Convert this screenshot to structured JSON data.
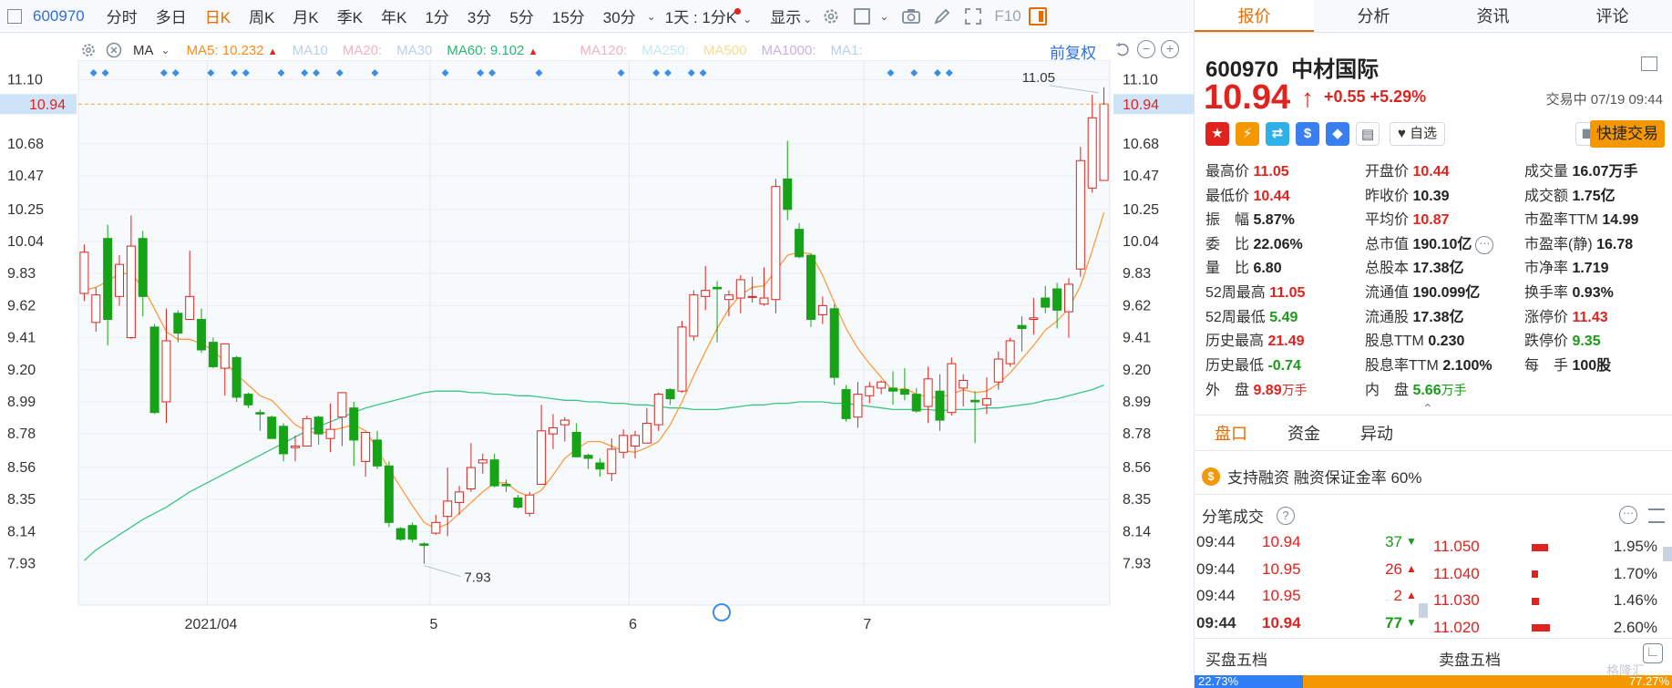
{
  "toolbar": {
    "code": "600970",
    "periods": [
      "分时",
      "多日",
      "日K",
      "周K",
      "月K",
      "季K",
      "年K",
      "1分",
      "3分",
      "5分",
      "15分",
      "30分"
    ],
    "active_period": "日K",
    "range_label": "1天 : 1分K",
    "display_label": "显示",
    "f10_label": "F10"
  },
  "indicators": {
    "ma_label": "MA",
    "ma5": "MA5: 10.232",
    "ma10": "MA10",
    "ma20": "MA20:",
    "ma30": "MA30",
    "ma60": "MA60: 9.102",
    "ma120": "MA120:",
    "ma250": "MA250:",
    "ma500": "MA500",
    "ma1000": "MA1000:",
    "ma1": "MA1:",
    "adjust_label": "前复权"
  },
  "chart_data": {
    "type": "candlestick",
    "title": "",
    "ylim": [
      7.85,
      11.18
    ],
    "yticks": [
      11.1,
      10.94,
      10.68,
      10.47,
      10.25,
      10.04,
      9.83,
      9.62,
      9.41,
      9.2,
      8.99,
      8.78,
      8.56,
      8.35,
      8.14,
      7.93
    ],
    "current_price_label": "10.94",
    "current_price": 10.94,
    "high_marker": {
      "label": "11.05",
      "value": 11.05
    },
    "low_marker": {
      "label": "7.93",
      "value": 7.93
    },
    "month_labels": [
      {
        "label": "2021/04",
        "index": 11
      },
      {
        "label": "5",
        "index": 30
      },
      {
        "label": "6",
        "index": 47
      },
      {
        "label": "7",
        "index": 67
      }
    ],
    "candles": [
      {
        "o": 9.7,
        "h": 10.02,
        "l": 9.65,
        "c": 9.97
      },
      {
        "o": 9.51,
        "h": 9.74,
        "l": 9.45,
        "c": 9.69
      },
      {
        "o": 10.06,
        "h": 10.15,
        "l": 9.36,
        "c": 9.53
      },
      {
        "o": 9.68,
        "h": 9.95,
        "l": 9.62,
        "c": 9.89
      },
      {
        "o": 9.41,
        "h": 10.21,
        "l": 9.4,
        "c": 10.01
      },
      {
        "o": 10.06,
        "h": 10.11,
        "l": 9.55,
        "c": 9.68
      },
      {
        "o": 9.48,
        "h": 9.5,
        "l": 8.91,
        "c": 8.92
      },
      {
        "o": 8.99,
        "h": 9.6,
        "l": 8.85,
        "c": 9.39
      },
      {
        "o": 9.57,
        "h": 9.59,
        "l": 9.38,
        "c": 9.44
      },
      {
        "o": 9.53,
        "h": 9.98,
        "l": 9.55,
        "c": 9.68
      },
      {
        "o": 9.53,
        "h": 9.6,
        "l": 9.31,
        "c": 9.33
      },
      {
        "o": 9.38,
        "h": 9.41,
        "l": 9.21,
        "c": 9.22
      },
      {
        "o": 9.21,
        "h": 9.23,
        "l": 9.03,
        "c": 9.37
      },
      {
        "o": 9.28,
        "h": 9.29,
        "l": 8.99,
        "c": 9.02
      },
      {
        "o": 9.04,
        "h": 9.05,
        "l": 8.95,
        "c": 8.97
      },
      {
        "o": 8.92,
        "h": 8.94,
        "l": 8.8,
        "c": 8.91
      },
      {
        "o": 8.89,
        "h": 8.9,
        "l": 8.79,
        "c": 8.75
      },
      {
        "o": 8.83,
        "h": 8.85,
        "l": 8.6,
        "c": 8.65
      },
      {
        "o": 8.69,
        "h": 8.77,
        "l": 8.6,
        "c": 8.7
      },
      {
        "o": 8.7,
        "h": 8.9,
        "l": 8.72,
        "c": 8.88
      },
      {
        "o": 8.89,
        "h": 8.9,
        "l": 8.71,
        "c": 8.78
      },
      {
        "o": 8.75,
        "h": 8.98,
        "l": 8.66,
        "c": 8.81
      },
      {
        "o": 8.89,
        "h": 9.05,
        "l": 8.7,
        "c": 9.05
      },
      {
        "o": 8.95,
        "h": 8.99,
        "l": 8.57,
        "c": 8.74
      },
      {
        "o": 8.6,
        "h": 8.78,
        "l": 8.5,
        "c": 8.79
      },
      {
        "o": 8.74,
        "h": 8.8,
        "l": 8.55,
        "c": 8.57
      },
      {
        "o": 8.57,
        "h": 8.6,
        "l": 8.17,
        "c": 8.2
      },
      {
        "o": 8.16,
        "h": 8.17,
        "l": 8.08,
        "c": 8.09
      },
      {
        "o": 8.18,
        "h": 8.2,
        "l": 8.07,
        "c": 8.09
      },
      {
        "o": 8.06,
        "h": 8.07,
        "l": 7.93,
        "c": 8.05
      },
      {
        "o": 8.13,
        "h": 8.25,
        "l": 8.12,
        "c": 8.2
      },
      {
        "o": 8.24,
        "h": 8.56,
        "l": 8.11,
        "c": 8.34
      },
      {
        "o": 8.33,
        "h": 8.44,
        "l": 8.25,
        "c": 8.4
      },
      {
        "o": 8.42,
        "h": 8.72,
        "l": 8.4,
        "c": 8.56
      },
      {
        "o": 8.59,
        "h": 8.65,
        "l": 8.52,
        "c": 8.61
      },
      {
        "o": 8.61,
        "h": 8.65,
        "l": 8.43,
        "c": 8.44
      },
      {
        "o": 8.45,
        "h": 8.48,
        "l": 8.4,
        "c": 8.44
      },
      {
        "o": 8.36,
        "h": 8.38,
        "l": 8.29,
        "c": 8.3
      },
      {
        "o": 8.26,
        "h": 8.4,
        "l": 8.24,
        "c": 8.38
      },
      {
        "o": 8.45,
        "h": 8.97,
        "l": 8.45,
        "c": 8.8
      },
      {
        "o": 8.78,
        "h": 8.91,
        "l": 8.68,
        "c": 8.82
      },
      {
        "o": 8.84,
        "h": 8.89,
        "l": 8.73,
        "c": 8.87
      },
      {
        "o": 8.79,
        "h": 8.85,
        "l": 8.65,
        "c": 8.63
      },
      {
        "o": 8.64,
        "h": 8.65,
        "l": 8.55,
        "c": 8.62
      },
      {
        "o": 8.59,
        "h": 8.62,
        "l": 8.5,
        "c": 8.55
      },
      {
        "o": 8.52,
        "h": 8.75,
        "l": 8.47,
        "c": 8.68
      },
      {
        "o": 8.66,
        "h": 8.81,
        "l": 8.62,
        "c": 8.77
      },
      {
        "o": 8.7,
        "h": 8.8,
        "l": 8.62,
        "c": 8.77
      },
      {
        "o": 8.72,
        "h": 8.95,
        "l": 8.72,
        "c": 8.85
      },
      {
        "o": 8.84,
        "h": 9.05,
        "l": 8.8,
        "c": 9.04
      },
      {
        "o": 9.07,
        "h": 9.08,
        "l": 8.97,
        "c": 9.01
      },
      {
        "o": 9.06,
        "h": 9.52,
        "l": 9.05,
        "c": 9.48
      },
      {
        "o": 9.42,
        "h": 9.72,
        "l": 9.39,
        "c": 9.69
      },
      {
        "o": 9.68,
        "h": 9.88,
        "l": 9.59,
        "c": 9.72
      },
      {
        "o": 9.74,
        "h": 9.78,
        "l": 9.38,
        "c": 9.73
      },
      {
        "o": 9.66,
        "h": 9.72,
        "l": 9.55,
        "c": 9.69
      },
      {
        "o": 9.67,
        "h": 9.82,
        "l": 9.57,
        "c": 9.79
      },
      {
        "o": 9.68,
        "h": 9.81,
        "l": 9.64,
        "c": 9.68
      },
      {
        "o": 9.63,
        "h": 9.87,
        "l": 9.62,
        "c": 9.67
      },
      {
        "o": 9.66,
        "h": 10.45,
        "l": 9.57,
        "c": 10.4
      },
      {
        "o": 10.45,
        "h": 10.7,
        "l": 10.18,
        "c": 10.25
      },
      {
        "o": 10.12,
        "h": 10.16,
        "l": 9.93,
        "c": 9.94
      },
      {
        "o": 9.95,
        "h": 9.96,
        "l": 9.48,
        "c": 9.53
      },
      {
        "o": 9.56,
        "h": 9.68,
        "l": 9.5,
        "c": 9.62
      },
      {
        "o": 9.6,
        "h": 9.63,
        "l": 9.1,
        "c": 9.15
      },
      {
        "o": 9.07,
        "h": 9.1,
        "l": 8.86,
        "c": 8.88
      },
      {
        "o": 8.89,
        "h": 9.12,
        "l": 8.82,
        "c": 9.04
      },
      {
        "o": 9.03,
        "h": 9.12,
        "l": 8.98,
        "c": 9.09
      },
      {
        "o": 9.08,
        "h": 9.13,
        "l": 9.04,
        "c": 9.12
      },
      {
        "o": 9.08,
        "h": 9.19,
        "l": 8.97,
        "c": 9.06
      }
    ],
    "ma5_line": [
      9.72,
      9.74,
      9.78,
      9.83,
      9.83,
      9.74,
      9.6,
      9.45,
      9.4,
      9.4,
      9.37,
      9.33,
      9.25,
      9.17,
      9.1,
      9.03,
      9.0,
      8.92,
      8.84,
      8.8,
      8.78,
      8.8,
      8.82,
      8.84,
      8.8,
      8.68,
      8.55,
      8.43,
      8.31,
      8.2,
      8.16,
      8.19,
      8.26,
      8.33,
      8.4,
      8.46,
      8.46,
      8.4,
      8.37,
      8.41,
      8.51,
      8.62,
      8.68,
      8.73,
      8.73,
      8.7,
      8.67,
      8.66,
      8.69,
      8.73,
      8.84,
      8.99,
      9.16,
      9.32,
      9.47,
      9.6,
      9.69,
      9.74,
      9.75,
      9.85,
      9.95,
      9.97,
      9.96,
      9.82,
      9.64,
      9.47,
      9.34,
      9.24,
      9.15,
      9.06
    ],
    "ma60_line": [
      7.95,
      8.02,
      8.07,
      8.12,
      8.17,
      8.22,
      8.26,
      8.3,
      8.35,
      8.4,
      8.44,
      8.48,
      8.52,
      8.56,
      8.6,
      8.64,
      8.68,
      8.72,
      8.76,
      8.8,
      8.83,
      8.86,
      8.89,
      8.92,
      8.95,
      8.97,
      8.99,
      9.01,
      9.03,
      9.05,
      9.06,
      9.06,
      9.06,
      9.05,
      9.05,
      9.04,
      9.04,
      9.03,
      9.03,
      9.02,
      9.01,
      9.0,
      9.0,
      8.99,
      8.99,
      8.98,
      8.98,
      8.97,
      8.97,
      8.96,
      8.95,
      8.95,
      8.94,
      8.94,
      8.94,
      8.95,
      8.96,
      8.97,
      8.97,
      8.98,
      8.98,
      8.99,
      8.99,
      8.99,
      8.98,
      8.98,
      8.97,
      8.96,
      8.95,
      8.94
    ]
  },
  "chart_data_tail": {
    "candles": [
      {
        "o": 9.07,
        "h": 9.21,
        "l": 9.0,
        "c": 9.04
      },
      {
        "o": 9.04,
        "h": 9.08,
        "l": 8.92,
        "c": 8.93
      },
      {
        "o": 8.96,
        "h": 9.22,
        "l": 8.85,
        "c": 9.14
      },
      {
        "o": 9.06,
        "h": 9.17,
        "l": 8.8,
        "c": 8.87
      },
      {
        "o": 8.92,
        "h": 9.28,
        "l": 8.9,
        "c": 9.24
      },
      {
        "o": 9.08,
        "h": 9.17,
        "l": 8.96,
        "c": 9.13
      },
      {
        "o": 9.0,
        "h": 9.06,
        "l": 8.72,
        "c": 8.99
      },
      {
        "o": 8.97,
        "h": 9.15,
        "l": 8.91,
        "c": 9.01
      },
      {
        "o": 9.12,
        "h": 9.32,
        "l": 9.07,
        "c": 9.27
      },
      {
        "o": 9.24,
        "h": 9.41,
        "l": 9.22,
        "c": 9.39
      },
      {
        "o": 9.49,
        "h": 9.55,
        "l": 9.32,
        "c": 9.47
      },
      {
        "o": 9.53,
        "h": 9.67,
        "l": 9.43,
        "c": 9.54
      },
      {
        "o": 9.67,
        "h": 9.75,
        "l": 9.57,
        "c": 9.61
      },
      {
        "o": 9.73,
        "h": 9.77,
        "l": 9.47,
        "c": 9.59
      },
      {
        "o": 9.58,
        "h": 9.8,
        "l": 9.41,
        "c": 9.76
      },
      {
        "o": 9.86,
        "h": 10.66,
        "l": 9.81,
        "c": 10.57
      },
      {
        "o": 10.39,
        "h": 11.0,
        "l": 10.36,
        "c": 10.85
      },
      {
        "o": 10.44,
        "h": 11.05,
        "l": 10.44,
        "c": 10.94
      }
    ],
    "ma5_line": [
      9.08,
      9.04,
      9.02,
      9.02,
      9.04,
      9.07,
      9.05,
      9.06,
      9.11,
      9.18,
      9.27,
      9.36,
      9.46,
      9.52,
      9.6,
      9.75,
      9.98,
      10.23
    ],
    "ma60_line": [
      8.94,
      8.94,
      8.94,
      8.93,
      8.94,
      8.94,
      8.94,
      8.95,
      8.95,
      8.96,
      8.97,
      8.98,
      9.0,
      9.01,
      9.03,
      9.05,
      9.07,
      9.1
    ]
  },
  "right_panel": {
    "tabs": [
      "报价",
      "分析",
      "资讯",
      "评论"
    ],
    "code": "600970",
    "name": "中材国际",
    "price": "10.94",
    "change": "+0.55",
    "change_pct": "+5.29%",
    "status": "交易中 07/19 09:44",
    "zixuan_label": "自选",
    "quick_trade_label": "快捷交易",
    "stats": [
      [
        {
          "l": "最高价",
          "v": "11.05",
          "c": "red"
        },
        {
          "l": "开盘价",
          "v": "10.44",
          "c": "red"
        },
        {
          "l": "成交量",
          "v": "16.07",
          "c": "dark",
          "u": "万手"
        }
      ],
      [
        {
          "l": "最低价",
          "v": "10.44",
          "c": "red"
        },
        {
          "l": "昨收价",
          "v": "10.39",
          "c": "dark"
        },
        {
          "l": "成交额",
          "v": "1.75亿",
          "c": "dark"
        }
      ],
      [
        {
          "l": "振　幅",
          "v": "5.87%",
          "c": "dark"
        },
        {
          "l": "平均价",
          "v": "10.87",
          "c": "red"
        },
        {
          "l": "市盈率TTM",
          "v": "14.99",
          "c": "dark"
        }
      ],
      [
        {
          "l": "委　比",
          "v": "22.06%",
          "c": "dark"
        },
        {
          "l": "总市值",
          "v": "190.10亿",
          "c": "dark"
        },
        {
          "l": "市盈率(静)",
          "v": "16.78",
          "c": "dark"
        }
      ],
      [
        {
          "l": "量　比",
          "v": "6.80",
          "c": "dark"
        },
        {
          "l": "总股本",
          "v": "17.38亿",
          "c": "dark"
        },
        {
          "l": "市净率",
          "v": "1.719",
          "c": "dark"
        }
      ],
      [
        {
          "l": "52周最高",
          "v": "11.05",
          "c": "red"
        },
        {
          "l": "流通值",
          "v": "190.099亿",
          "c": "dark"
        },
        {
          "l": "换手率",
          "v": "0.93%",
          "c": "dark"
        }
      ],
      [
        {
          "l": "52周最低",
          "v": "5.49",
          "c": "green"
        },
        {
          "l": "流通股",
          "v": "17.38亿",
          "c": "dark"
        },
        {
          "l": "涨停价",
          "v": "11.43",
          "c": "red"
        }
      ],
      [
        {
          "l": "历史最高",
          "v": "21.49",
          "c": "red"
        },
        {
          "l": "股息TTM",
          "v": "0.230",
          "c": "dark"
        },
        {
          "l": "跌停价",
          "v": "9.35",
          "c": "green"
        }
      ],
      [
        {
          "l": "历史最低",
          "v": "-0.74",
          "c": "green"
        },
        {
          "l": "股息率TTM",
          "v": "2.100%",
          "c": "dark"
        },
        {
          "l": "每　手",
          "v": "100股",
          "c": "dark"
        }
      ],
      [
        {
          "l": "外　盘",
          "v": "9.89",
          "c": "red",
          "u": "万手"
        },
        {
          "l": "内　盘",
          "v": "5.66",
          "c": "green",
          "u": "万手"
        }
      ]
    ],
    "subtabs": [
      "盘口",
      "资金",
      "异动"
    ],
    "margin_text": "支持融资  融资保证金率 60%",
    "ticks_title": "分笔成交",
    "ticks": [
      {
        "time": "09:44",
        "price": "10.94",
        "vol": "37",
        "dir": "down"
      },
      {
        "time": "09:44",
        "price": "10.95",
        "vol": "26",
        "dir": "up"
      },
      {
        "time": "09:44",
        "price": "10.95",
        "vol": "2",
        "dir": "up"
      },
      {
        "time": "09:44",
        "price": "10.94",
        "vol": "77",
        "dir": "down"
      }
    ],
    "asks": [
      {
        "price": "11.050",
        "pct": "1.95%",
        "bar": 0.36
      },
      {
        "price": "11.040",
        "pct": "1.70%",
        "bar": 0.08
      },
      {
        "price": "11.030",
        "pct": "1.46%",
        "bar": 0.1
      },
      {
        "price": "11.020",
        "pct": "2.60%",
        "bar": 0.4
      }
    ],
    "buy5_label": "买盘五档",
    "sell5_label": "卖盘五档",
    "buy_pct": "22.73%",
    "sell_pct": "77.27%",
    "buy_ratio": 0.2273,
    "watermark": "格隆汇"
  },
  "colors": {
    "up": "#e0231e",
    "down": "#17a317",
    "ma5": "#ff9a3c",
    "ma60": "#3cc483",
    "accent": "#e86b00"
  }
}
